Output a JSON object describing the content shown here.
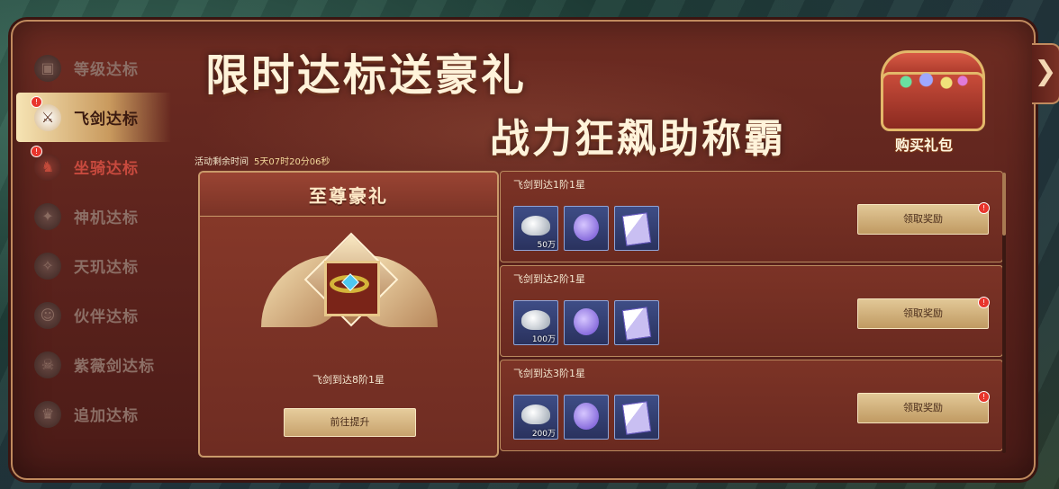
{
  "banner": {
    "title_line1": "限时达标送豪礼",
    "title_line2": "战力狂飙助称霸",
    "gift_button": "购买礼包"
  },
  "close_icon": "chevron-right-icon",
  "sidebar": {
    "items": [
      {
        "label": "等级达标",
        "icon": "gift-icon",
        "active": false,
        "alert": false
      },
      {
        "label": "飞剑达标",
        "icon": "flying-sword-icon",
        "active": true,
        "alert": true
      },
      {
        "label": "坐骑达标",
        "icon": "horse-icon",
        "active": false,
        "alert": true
      },
      {
        "label": "神机达标",
        "icon": "mech-icon",
        "active": false,
        "alert": false
      },
      {
        "label": "天玑达标",
        "icon": "helm-icon",
        "active": false,
        "alert": false
      },
      {
        "label": "伙伴达标",
        "icon": "partner-icon",
        "active": false,
        "alert": false
      },
      {
        "label": "紫薇剑达标",
        "icon": "sword-icon",
        "active": false,
        "alert": false
      },
      {
        "label": "追加达标",
        "icon": "crown-icon",
        "active": false,
        "alert": false
      }
    ]
  },
  "timer": {
    "label": "活动剩余时间",
    "value": "5天07时20分06秒"
  },
  "supreme": {
    "title": "至尊豪礼",
    "condition": "飞剑到达8阶1星",
    "button": "前往提升"
  },
  "rewards": [
    {
      "title": "飞剑到达1阶1星",
      "silver_amount": "50万",
      "button": "领取奖励"
    },
    {
      "title": "飞剑到达2阶1星",
      "silver_amount": "100万",
      "button": "领取奖励"
    },
    {
      "title": "飞剑到达3阶1星",
      "silver_amount": "200万",
      "button": "领取奖励"
    }
  ],
  "colors": {
    "frame": "#5a221c",
    "border_gold": "#c08a5e",
    "alert_red": "#e8352c",
    "button_gold": "#e2c897"
  }
}
